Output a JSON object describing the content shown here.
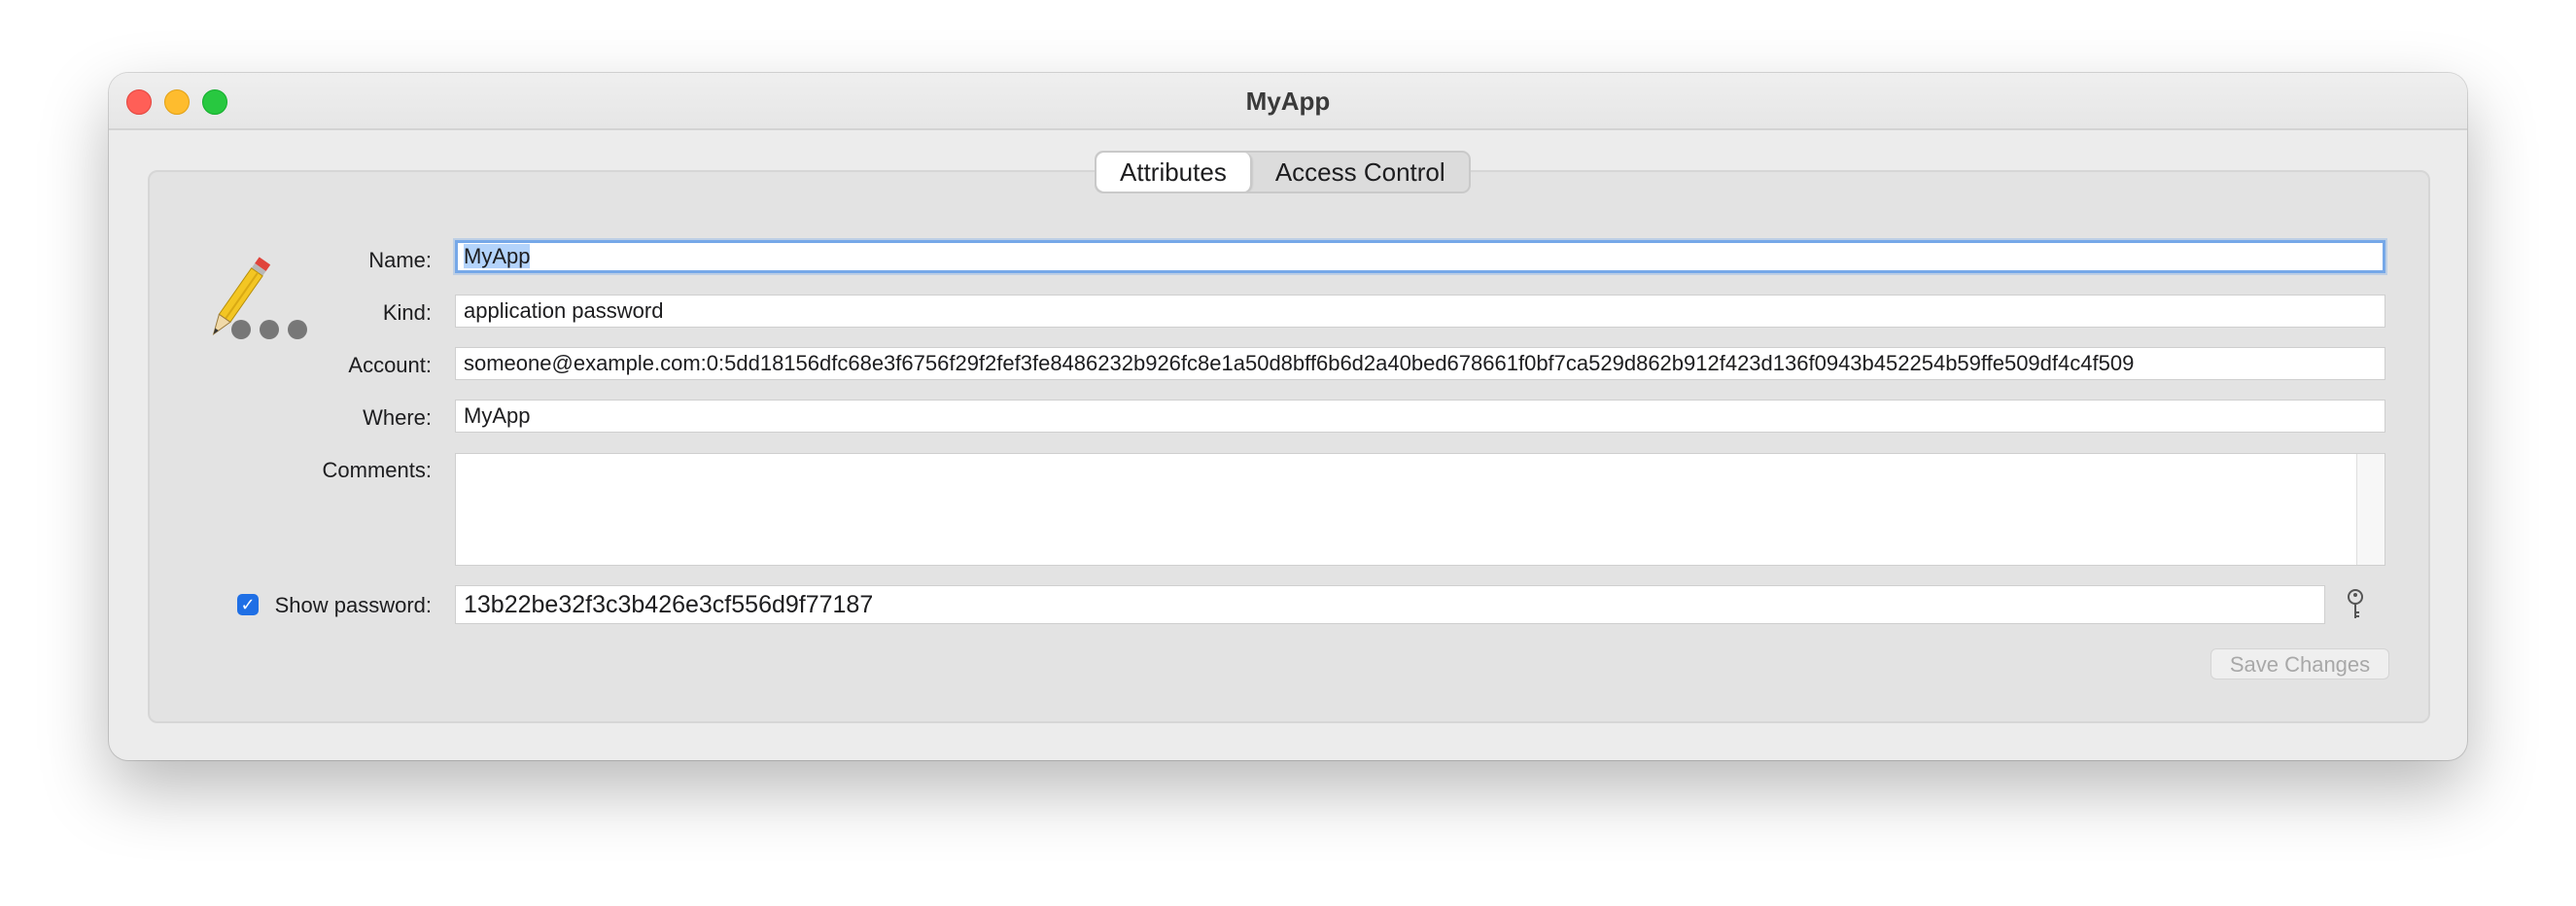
{
  "window": {
    "title": "MyApp"
  },
  "tabs": [
    {
      "label": "Attributes",
      "active": true
    },
    {
      "label": "Access Control",
      "active": false
    }
  ],
  "form": {
    "name_label": "Name:",
    "name_value": "MyApp",
    "kind_label": "Kind:",
    "kind_value": "application password",
    "account_label": "Account:",
    "account_value": "someone@example.com:0:5dd18156dfc68e3f6756f29f2fef3fe8486232b926fc8e1a50d8bff6b6d2a40bed678661f0bf7ca529d862b912f423d136f0943b452254b59ffe509df4c4f509",
    "where_label": "Where:",
    "where_value": "MyApp",
    "comments_label": "Comments:",
    "comments_value": "",
    "show_password_label": "Show password:",
    "show_password_checked": true,
    "password_value": "13b22be32f3c3b426e3cf556d9f77187"
  },
  "buttons": {
    "save_label": "Save Changes",
    "save_enabled": false
  },
  "icons": {
    "item_icon": "pencil-ellipsis-icon",
    "key_icon": "key-icon"
  },
  "colors": {
    "accent": "#1f6fe5",
    "focus_ring": "#76a8e8",
    "selection": "#b3d3fb"
  }
}
